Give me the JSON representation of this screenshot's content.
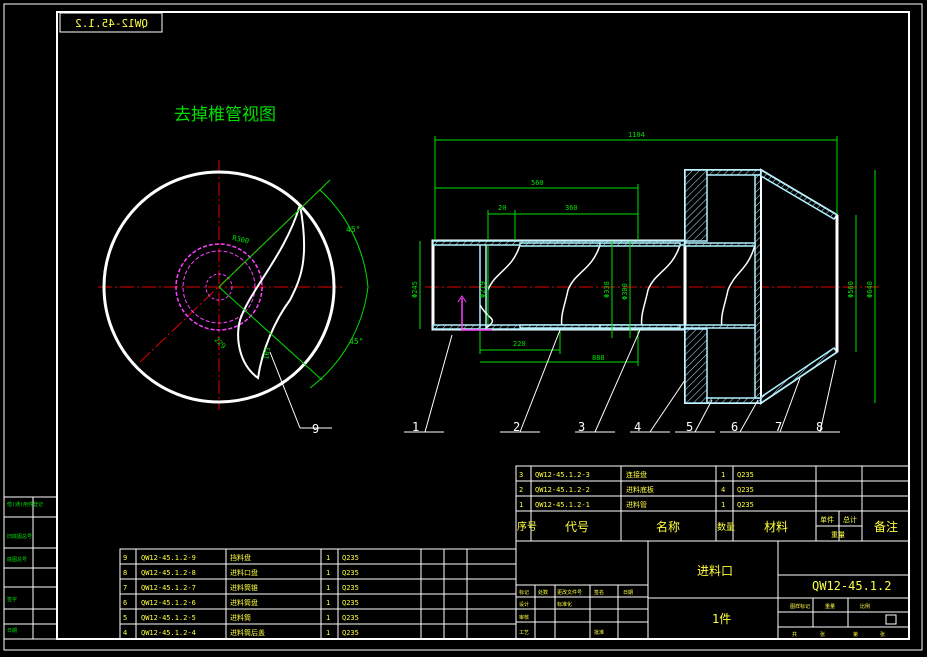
{
  "drawing": {
    "code_top": "QW12-45.1.2",
    "view_title": "去掉椎管视图",
    "dims": {
      "total_length": "1104",
      "d560": "560",
      "d20": "20",
      "d360": "360",
      "d220": "220",
      "d888": "888",
      "phi245": "Φ245",
      "phi219": "Φ219",
      "phi338": "Φ338",
      "phi300": "Φ300",
      "phi560": "Φ560",
      "phi640": "Φ640",
      "r300": "R300",
      "a45a": "45°",
      "a45b": "45°",
      "d229": "229",
      "d103": "103"
    },
    "balloons": [
      "1",
      "2",
      "3",
      "4",
      "5",
      "6",
      "7",
      "8",
      "9"
    ]
  },
  "bom_right": {
    "rows": [
      {
        "no": "3",
        "code": "QW12-45.1.2-3",
        "name": "连接盘",
        "qty": "1",
        "mat": "Q235"
      },
      {
        "no": "2",
        "code": "QW12-45.1.2-2",
        "name": "进料底板",
        "qty": "4",
        "mat": "Q235"
      },
      {
        "no": "1",
        "code": "QW12-45.1.2-1",
        "name": "进料管",
        "qty": "1",
        "mat": "Q235"
      }
    ],
    "header": {
      "no": "序号",
      "code": "代号",
      "name": "名称",
      "qty": "数量",
      "mat": "材料",
      "unit": "单件",
      "total": "总计",
      "weight": "重量",
      "remark": "备注"
    }
  },
  "bom_left": {
    "rows": [
      {
        "no": "9",
        "code": "QW12-45.1.2-9",
        "name": "挡料盘",
        "qty": "1",
        "mat": "Q235"
      },
      {
        "no": "8",
        "code": "QW12-45.1.2-8",
        "name": "进料口盘",
        "qty": "1",
        "mat": "Q235"
      },
      {
        "no": "7",
        "code": "QW12-45.1.2-7",
        "name": "进料筒锥",
        "qty": "1",
        "mat": "Q235"
      },
      {
        "no": "6",
        "code": "QW12-45.1.2-6",
        "name": "进料筒盘",
        "qty": "1",
        "mat": "Q235"
      },
      {
        "no": "5",
        "code": "QW12-45.1.2-5",
        "name": "进料筒",
        "qty": "1",
        "mat": "Q235"
      },
      {
        "no": "4",
        "code": "QW12-45.1.2-4",
        "name": "进料筒后盖",
        "qty": "1",
        "mat": "Q235"
      }
    ]
  },
  "title_block": {
    "name": "进料口",
    "code": "QW12-45.1.2",
    "count": "1件",
    "small_labels": [
      "标记",
      "处数",
      "更改文件号",
      "签名",
      "日期",
      "设计",
      "审核",
      "工艺",
      "标准化",
      "批准",
      "图样标记",
      "重量",
      "比例",
      "共",
      "张",
      "第",
      "张"
    ]
  },
  "side_strip": [
    "借(通)用件登记",
    "旧底图总号",
    "底图总号",
    "签字",
    "日期"
  ]
}
